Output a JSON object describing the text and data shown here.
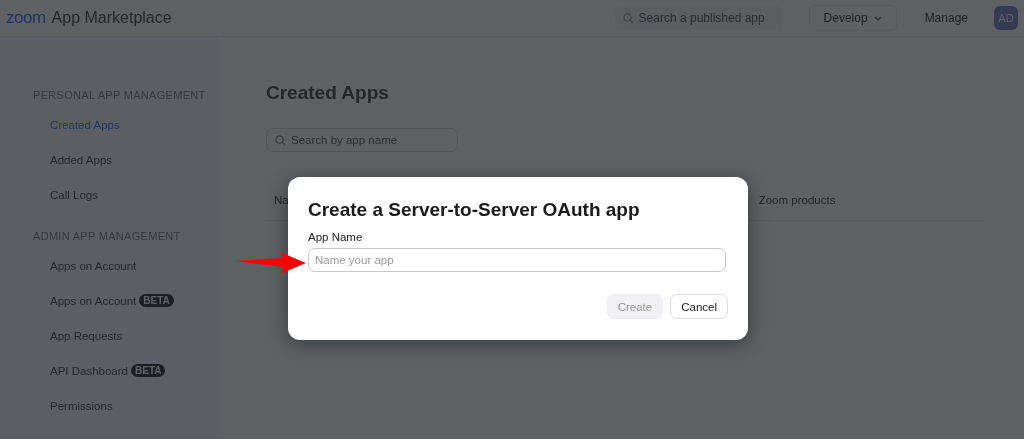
{
  "header": {
    "logo": "zoom",
    "title": "App Marketplace",
    "search": {
      "placeholder": "Search a published app"
    },
    "develop": "Develop",
    "manage": "Manage",
    "avatar": "AD"
  },
  "sidebar": {
    "sections": [
      {
        "heading": "PERSONAL APP MANAGEMENT",
        "items": [
          {
            "label": "Created Apps",
            "selected": true
          },
          {
            "label": "Added Apps",
            "selected": false
          },
          {
            "label": "Call Logs",
            "selected": false
          }
        ]
      },
      {
        "heading": "ADMIN APP MANAGEMENT",
        "items": [
          {
            "label": "Apps on Account",
            "selected": false
          },
          {
            "label": "Apps on Account",
            "badge": "BETA",
            "selected": false
          },
          {
            "label": "App Requests",
            "selected": false
          },
          {
            "label": "API Dashboard",
            "badge": "BETA",
            "selected": false
          },
          {
            "label": "Permissions",
            "selected": false
          }
        ]
      }
    ]
  },
  "main": {
    "title": "Created Apps",
    "search": {
      "placeholder": "Search by app name"
    },
    "table": {
      "columns": [
        "Na",
        "Zoom products"
      ]
    }
  },
  "dialog": {
    "title": "Create a Server-to-Server OAuth app",
    "field_label": "App Name",
    "field": {
      "placeholder": "Name your app"
    },
    "buttons": [
      {
        "label": "Create",
        "disabled": true
      },
      {
        "label": "Cancel",
        "disabled": false
      }
    ]
  }
}
